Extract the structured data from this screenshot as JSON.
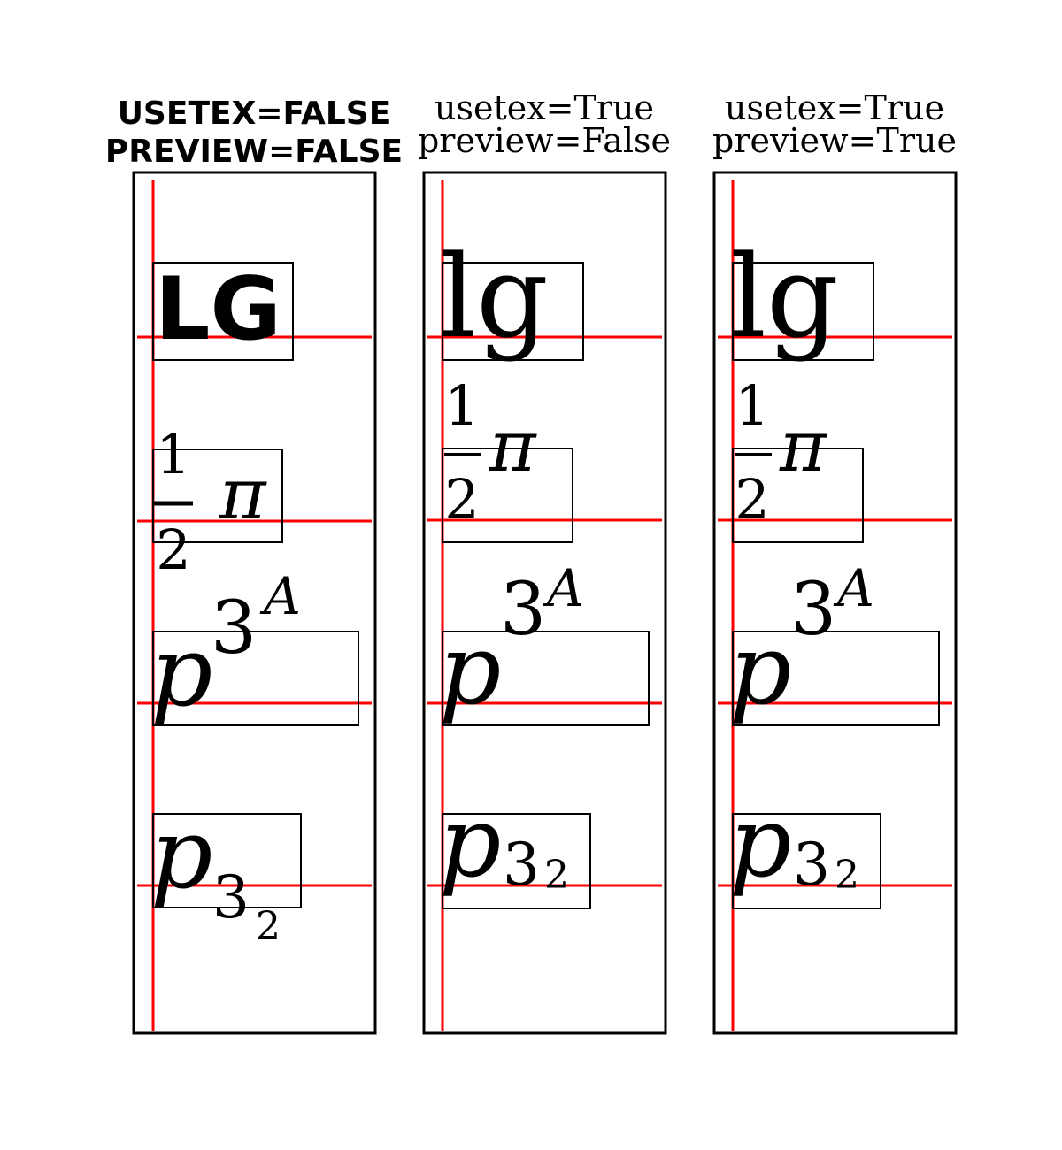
{
  "panels": [
    {
      "title_line1": "USETEX=FALSE",
      "title_line2": "PREVIEW=FALSE",
      "style": "hand",
      "samples": [
        {
          "main": "LG"
        },
        {
          "num": "1",
          "den": "2",
          "sym": "π"
        },
        {
          "base": "p",
          "sup": "3",
          "supsup": "A"
        },
        {
          "base": "p",
          "sub": "3",
          "subsub": "2"
        }
      ]
    },
    {
      "title_line1": "usetex=True",
      "title_line2": "preview=False",
      "style": "serif",
      "samples": [
        {
          "main": "lg"
        },
        {
          "num": "1",
          "den": "2",
          "sym": "π"
        },
        {
          "base": "p",
          "sup": "3",
          "supsup": "A"
        },
        {
          "base": "p",
          "sub": "3",
          "subsub": "2"
        }
      ]
    },
    {
      "title_line1": "usetex=True",
      "title_line2": "preview=True",
      "style": "serif",
      "samples": [
        {
          "main": "lg"
        },
        {
          "num": "1",
          "den": "2",
          "sym": "π"
        },
        {
          "base": "p",
          "sup": "3",
          "supsup": "A"
        },
        {
          "base": "p",
          "sub": "3",
          "subsub": "2"
        }
      ]
    }
  ],
  "colors": {
    "baseline": "#ff0000",
    "frame": "#000000",
    "text": "#000000",
    "background": "#ffffff"
  }
}
